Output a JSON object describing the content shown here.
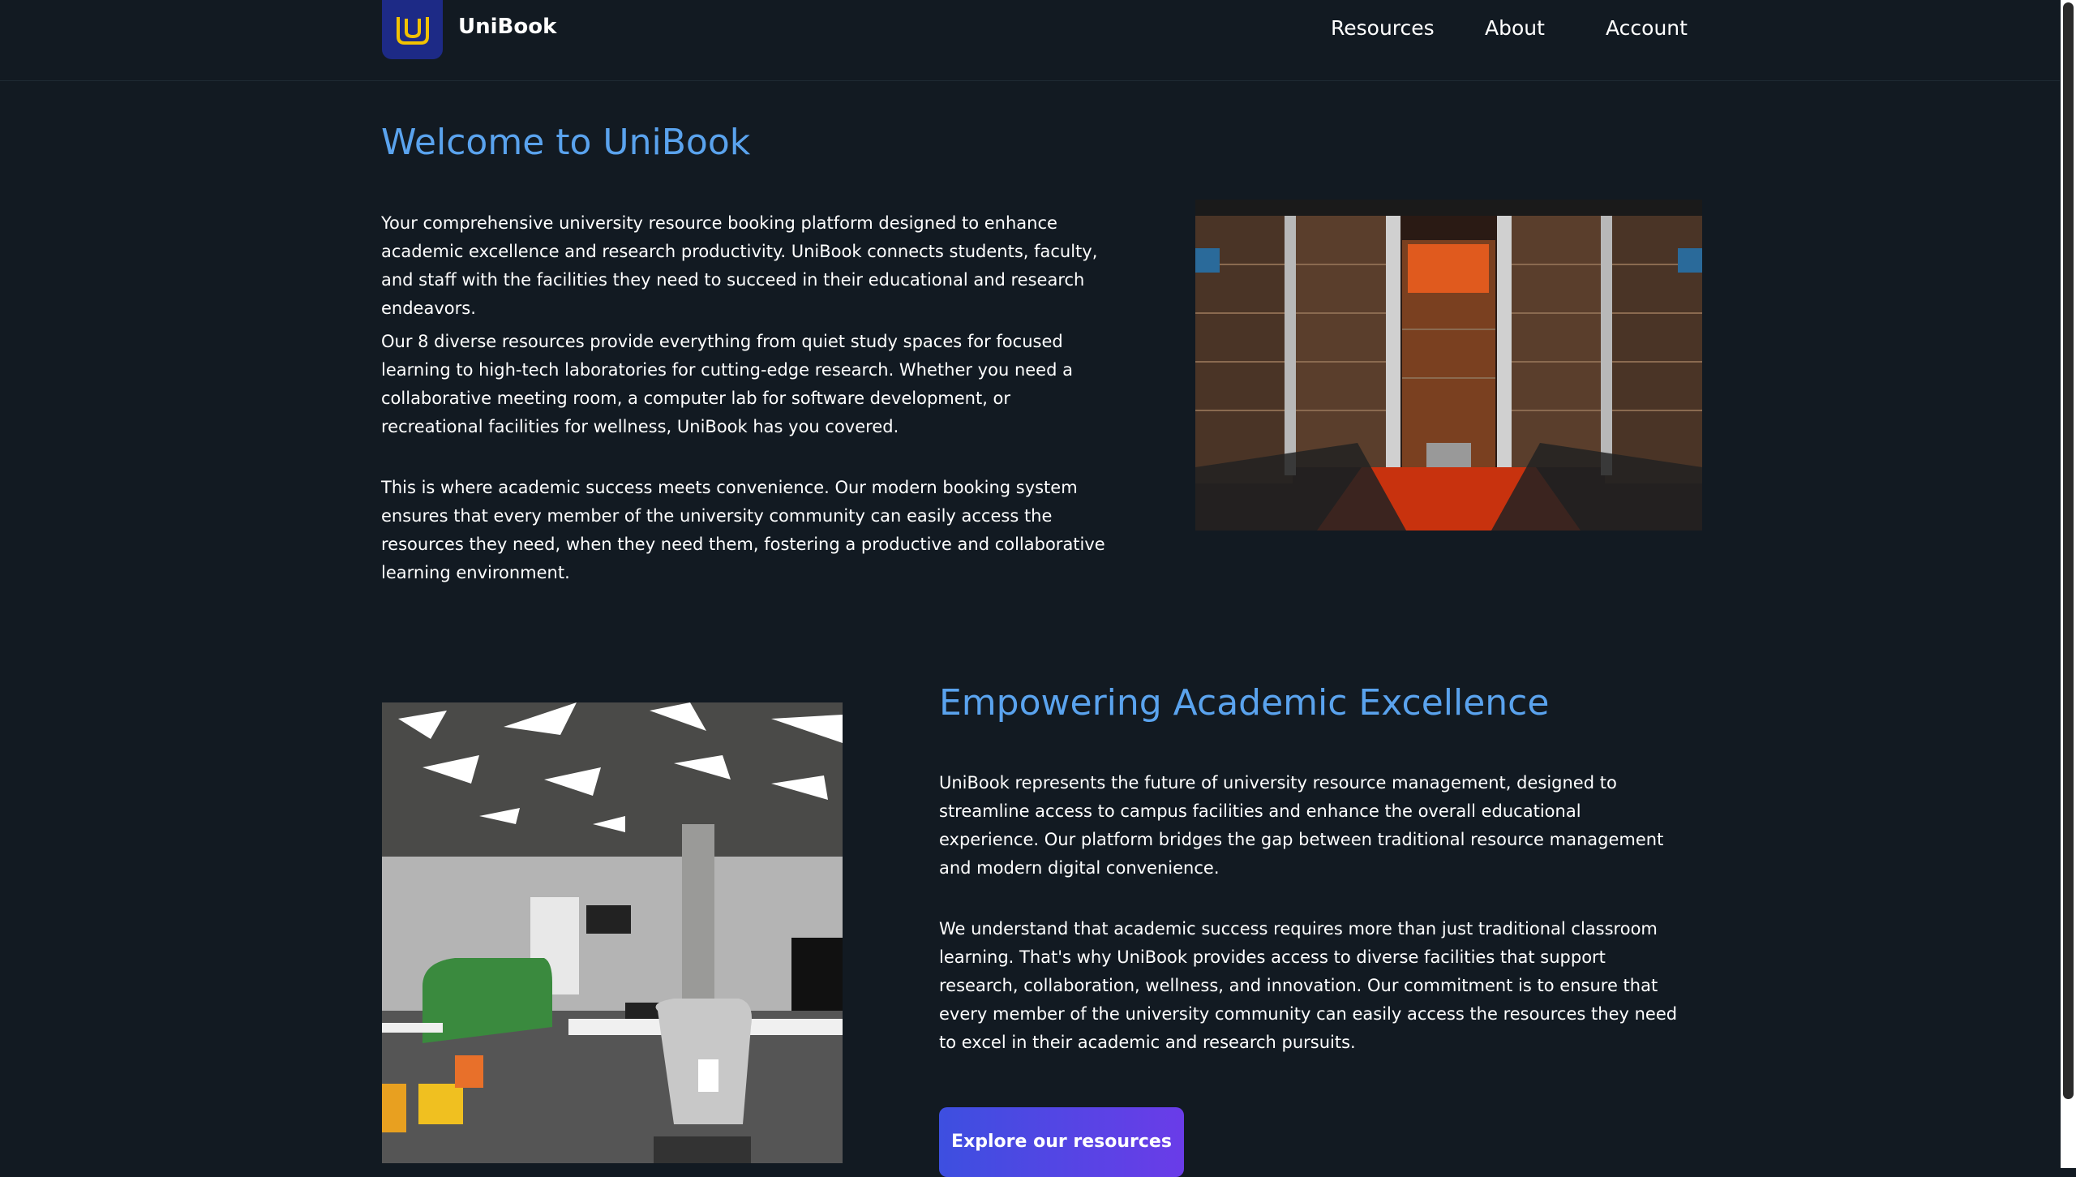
{
  "header": {
    "brand": "UniBook",
    "nav": [
      "Resources",
      "About",
      "Account"
    ]
  },
  "intro": {
    "title": "Welcome to UniBook",
    "paragraphs": [
      "Your comprehensive university resource booking platform designed to enhance academic excellence and research productivity. UniBook connects students, faculty, and staff with the facilities they need to succeed in their educational and research endeavors.",
      "Our 8 diverse resources provide everything from quiet study spaces for focused learning to high-tech laboratories for cutting-edge research. Whether you need a collaborative meeting room, a computer lab for software development, or recreational facilities for wellness, UniBook has you covered.",
      "This is where academic success meets convenience. Our modern booking system ensures that every member of the university community can easily access the resources they need, when they need them, fostering a productive and collaborative learning environment."
    ]
  },
  "mission": {
    "title": "Empowering Academic Excellence",
    "paragraphs": [
      "UniBook represents the future of university resource management, designed to streamline access to campus facilities and enhance the overall educational experience. Our platform bridges the gap between traditional resource management and modern digital convenience.",
      "We understand that academic success requires more than just traditional classroom learning. That's why UniBook provides access to diverse facilities that support research, collaboration, wellness, and innovation. Our commitment is to ensure that every member of the university community can easily access the resources they need to excel in their academic and research pursuits."
    ],
    "cta_label": "Explore our resources"
  },
  "colors": {
    "background": "#121a22",
    "accent_title": "#5aa3ee",
    "logo_bg": "#1d2a86",
    "logo_mark": "#f2c200",
    "cta_start": "#3d4fe0",
    "cta_end": "#6a3ce8"
  },
  "icons": {
    "logo": "unibook-logo-icon"
  }
}
